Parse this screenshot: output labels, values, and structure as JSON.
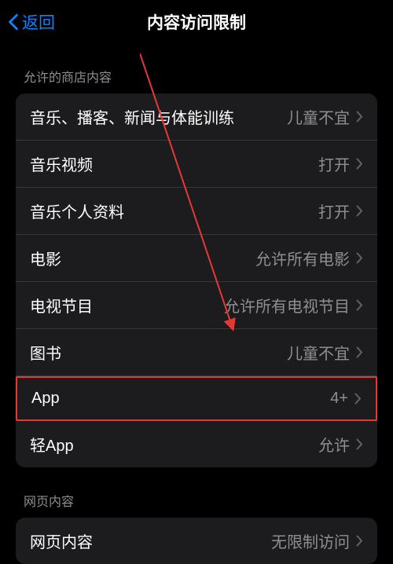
{
  "header": {
    "back_label": "返回",
    "title": "内容访问限制"
  },
  "sections": {
    "store": {
      "header": "允许的商店内容",
      "items": [
        {
          "label": "音乐、播客、新闻与体能训练",
          "value": "儿童不宜"
        },
        {
          "label": "音乐视频",
          "value": "打开"
        },
        {
          "label": "音乐个人资料",
          "value": "打开"
        },
        {
          "label": "电影",
          "value": "允许所有电影"
        },
        {
          "label": "电视节目",
          "value": "允许所有电视节目"
        },
        {
          "label": "图书",
          "value": "儿童不宜"
        },
        {
          "label": "App",
          "value": "4+"
        },
        {
          "label": "轻App",
          "value": "允许"
        }
      ]
    },
    "web": {
      "header": "网页内容",
      "items": [
        {
          "label": "网页内容",
          "value": "无限制访问"
        }
      ]
    }
  }
}
